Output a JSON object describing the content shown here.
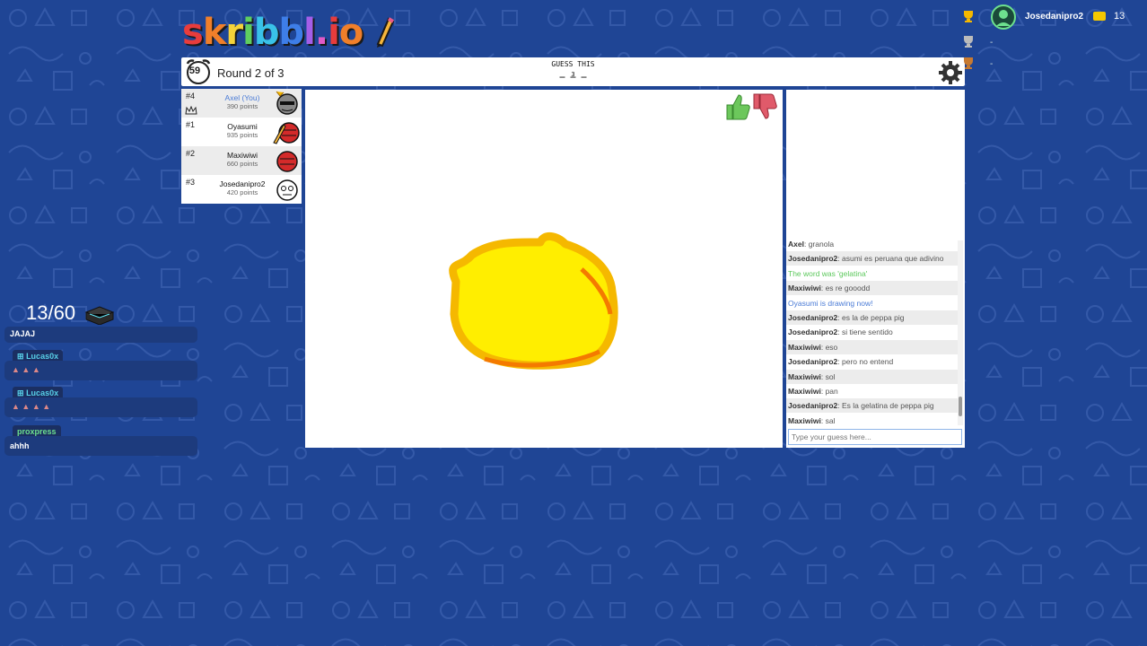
{
  "logo": {
    "text": "skribbl.io"
  },
  "game": {
    "timer": "59",
    "round_label": "Round 2 of 3",
    "guess_title": "GUESS THIS",
    "word_hint": "_ _ _",
    "word_length": "3"
  },
  "players": [
    {
      "rank": "#4",
      "name": "Axel (You)",
      "points": "390 points",
      "is_you": true
    },
    {
      "rank": "#1",
      "name": "Oyasumi",
      "points": "935 points",
      "is_you": false
    },
    {
      "rank": "#2",
      "name": "Maxiwiwi",
      "points": "660 points",
      "is_you": false
    },
    {
      "rank": "#3",
      "name": "Josedanipro2",
      "points": "420 points",
      "is_you": false
    }
  ],
  "chat": {
    "messages": [
      {
        "name": "Axel",
        "text": "granola",
        "kind": "normal"
      },
      {
        "name": "Josedanipro2",
        "text": "asumi es peruana que adivino",
        "kind": "normal"
      },
      {
        "name": "",
        "text": "The word was 'gelatina'",
        "kind": "green"
      },
      {
        "name": "Maxiwiwi",
        "text": "es re gooodd",
        "kind": "normal"
      },
      {
        "name": "",
        "text": "Oyasumi is drawing now!",
        "kind": "blue"
      },
      {
        "name": "Josedanipro2",
        "text": "es la de peppa pig",
        "kind": "normal"
      },
      {
        "name": "Josedanipro2",
        "text": "si tiene sentido",
        "kind": "normal"
      },
      {
        "name": "Maxiwiwi",
        "text": "eso",
        "kind": "normal"
      },
      {
        "name": "Josedanipro2",
        "text": "pero no entend",
        "kind": "normal"
      },
      {
        "name": "Maxiwiwi",
        "text": "sol",
        "kind": "normal"
      },
      {
        "name": "Maxiwiwi",
        "text": "pan",
        "kind": "normal"
      },
      {
        "name": "Josedanipro2",
        "text": "Es la gelatina de peppa pig",
        "kind": "normal"
      },
      {
        "name": "Maxiwiwi",
        "text": "sal",
        "kind": "normal"
      }
    ],
    "input_placeholder": "Type your guess here..."
  },
  "overlay": {
    "counter": "13/60",
    "messages": [
      {
        "user": "",
        "text": "JAJAJ"
      },
      {
        "user": "Lucas0x",
        "text": ""
      },
      {
        "user": "Lucas0x",
        "text": ""
      },
      {
        "user": "proxpress",
        "text": "ahhh"
      }
    ]
  },
  "leaderboard": {
    "username": "Josedanipro2",
    "score": "13",
    "places": [
      "-",
      "-"
    ]
  },
  "colors": {
    "background": "#1f4595",
    "you": "#4a7bd6",
    "correct": "#5cc85c",
    "drawing_yellow": "#ffee00",
    "drawing_orange": "#f5b800"
  }
}
